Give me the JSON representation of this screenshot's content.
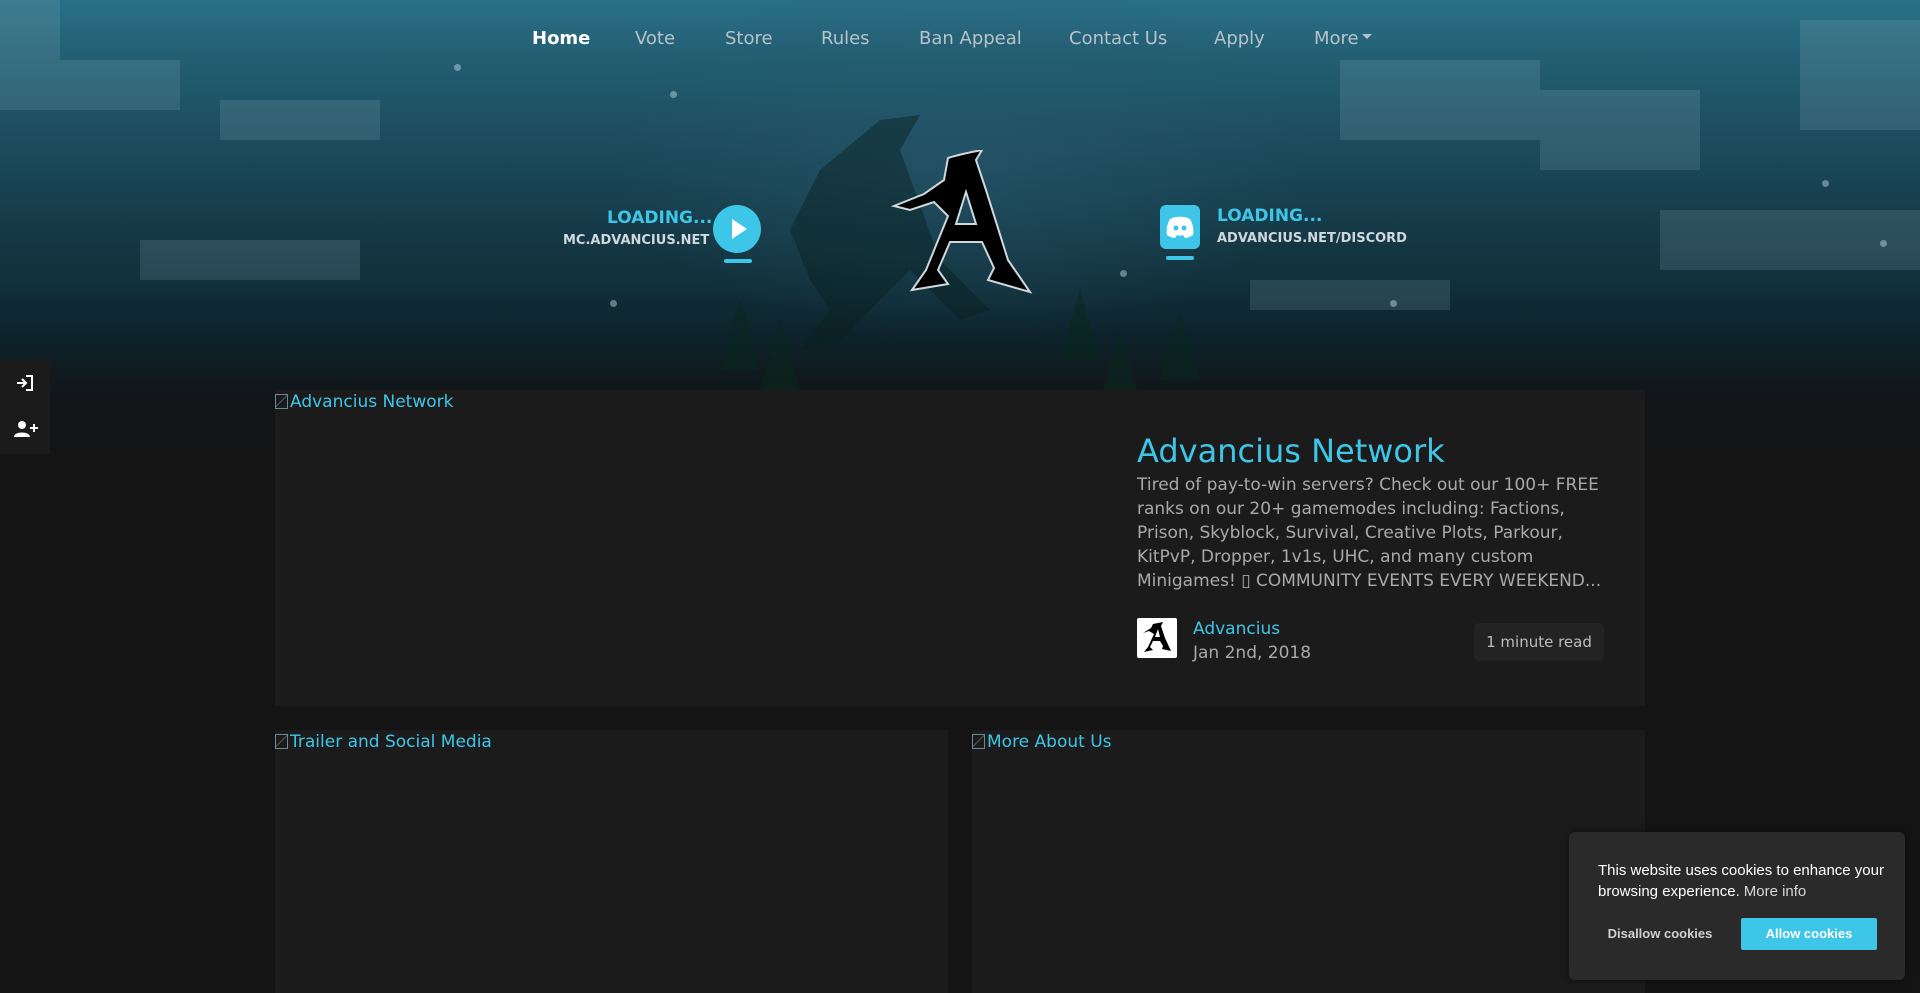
{
  "nav": {
    "items": [
      {
        "label": "Home",
        "active": true
      },
      {
        "label": "Vote"
      },
      {
        "label": "Store"
      },
      {
        "label": "Rules"
      },
      {
        "label": "Ban Appeal"
      },
      {
        "label": "Contact Us"
      },
      {
        "label": "Apply"
      },
      {
        "label": "More"
      }
    ]
  },
  "server": {
    "status": "LOADING...",
    "address": "MC.ADVANCIUS.NET"
  },
  "discord": {
    "status": "LOADING...",
    "address": "ADVANCIUS.NET/DISCORD"
  },
  "side_panel": {
    "icons": [
      "sign-in-icon",
      "user-plus-icon"
    ]
  },
  "featured_post": {
    "image_alt": "Advancius Network",
    "title": "Advancius Network",
    "excerpt": "Tired of pay-to-win servers? Check out our 100+ FREE ranks on our 20+ gamemodes including: Factions, Prison, Skyblock, Survival, Creative Plots, Parkour, KitPvP, Dropper, 1v1s, UHC, and many custom Minigames! ▯ COMMUNITY EVENTS EVERY WEEKEND...",
    "author": "Advancius",
    "date": "Jan 2nd, 2018",
    "read_time": "1 minute read"
  },
  "posts": [
    {
      "image_alt": "Trailer and Social Media"
    },
    {
      "image_alt": "More About Us"
    }
  ],
  "cookie_banner": {
    "message": "This website uses cookies to enhance your browsing experience.",
    "more_info": "More info",
    "disallow": "Disallow cookies",
    "allow": "Allow cookies"
  },
  "colors": {
    "accent": "#3ec6e8",
    "background": "#141414",
    "card": "#1b1b1b"
  }
}
